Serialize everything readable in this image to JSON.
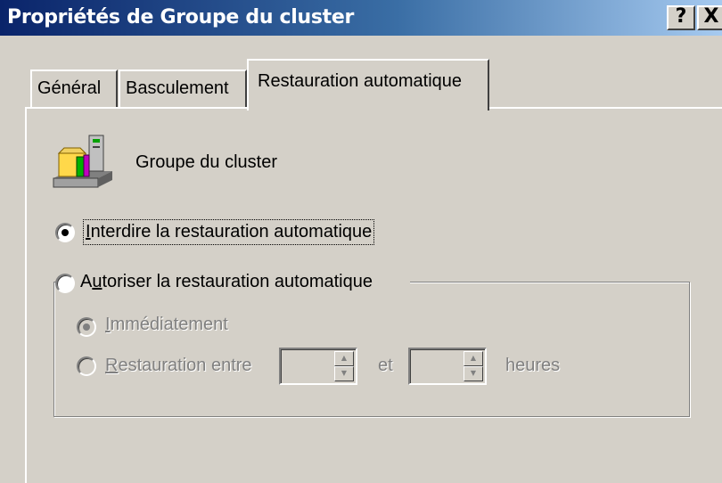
{
  "window": {
    "title": "Propriétés de Groupe du cluster",
    "help_label": "?",
    "close_label": "X"
  },
  "tabs": [
    {
      "label": "Général",
      "active": false
    },
    {
      "label": "Basculement",
      "active": false
    },
    {
      "label": "Restauration automatique",
      "active": true
    }
  ],
  "group": {
    "icon": "cluster-group-icon",
    "name": "Groupe du cluster"
  },
  "options": {
    "deny": {
      "mnemonic": "I",
      "rest": "nterdire la restauration automatique",
      "selected": true
    },
    "allow": {
      "prefix": "A",
      "mnemonic": "u",
      "rest": "toriser la restauration automatique",
      "selected": false
    }
  },
  "allow_group": {
    "immediate": {
      "mnemonic": "I",
      "rest": "mmédiatement",
      "selected": true,
      "enabled": false
    },
    "between": {
      "mnemonic": "R",
      "rest": "estauration entre",
      "selected": false,
      "enabled": false
    },
    "from_value": "",
    "and_label": "et",
    "to_value": "",
    "hours_label": "heures"
  },
  "colors": {
    "titlebar_start": "#0a246a",
    "titlebar_end": "#a6caf0",
    "face": "#d4d0c8",
    "disabled_text": "#808080"
  }
}
